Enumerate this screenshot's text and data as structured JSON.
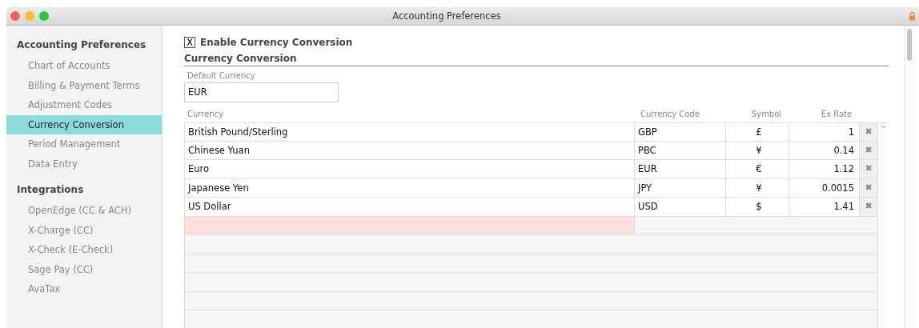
{
  "window": {
    "title": "Accounting Preferences"
  },
  "sidebar": {
    "sections": [
      {
        "title": "Accounting Preferences",
        "items": [
          {
            "label": "Chart of Accounts",
            "selected": false
          },
          {
            "label": "Billing & Payment Terms",
            "selected": false
          },
          {
            "label": "Adjustment Codes",
            "selected": false
          },
          {
            "label": "Currency Conversion",
            "selected": true
          },
          {
            "label": "Period Management",
            "selected": false
          },
          {
            "label": "Data Entry",
            "selected": false
          }
        ]
      },
      {
        "title": "Integrations",
        "items": [
          {
            "label": "OpenEdge (CC & ACH)",
            "selected": false
          },
          {
            "label": "X-Charge (CC)",
            "selected": false
          },
          {
            "label": "X-Check (E-Check)",
            "selected": false
          },
          {
            "label": "Sage Pay (CC)",
            "selected": false
          },
          {
            "label": "AvaTax",
            "selected": false
          }
        ]
      }
    ]
  },
  "enable_checkbox": {
    "label": "Enable Currency Conversion",
    "checked": true,
    "mark": "X"
  },
  "section_title": "Currency Conversion",
  "default_currency": {
    "label": "Default Currency",
    "value": "EUR"
  },
  "table": {
    "columns": [
      "Currency",
      "Currency Code",
      "Symbol",
      "Ex Rate"
    ],
    "rows": [
      {
        "currency": "British Pound/Sterling",
        "code": "GBP",
        "symbol": "£",
        "rate": "1"
      },
      {
        "currency": "Chinese Yuan",
        "code": "PBC",
        "symbol": "¥",
        "rate": "0.14"
      },
      {
        "currency": "Euro",
        "code": "EUR",
        "symbol": "€",
        "rate": "1.12"
      },
      {
        "currency": "Japanese Yen",
        "code": "JPY",
        "symbol": "¥",
        "rate": "0.0015"
      },
      {
        "currency": "US Dollar",
        "code": "USD",
        "symbol": "$",
        "rate": "1.41"
      }
    ],
    "delete_glyph": "✖",
    "scroll_up_glyph": "^"
  }
}
